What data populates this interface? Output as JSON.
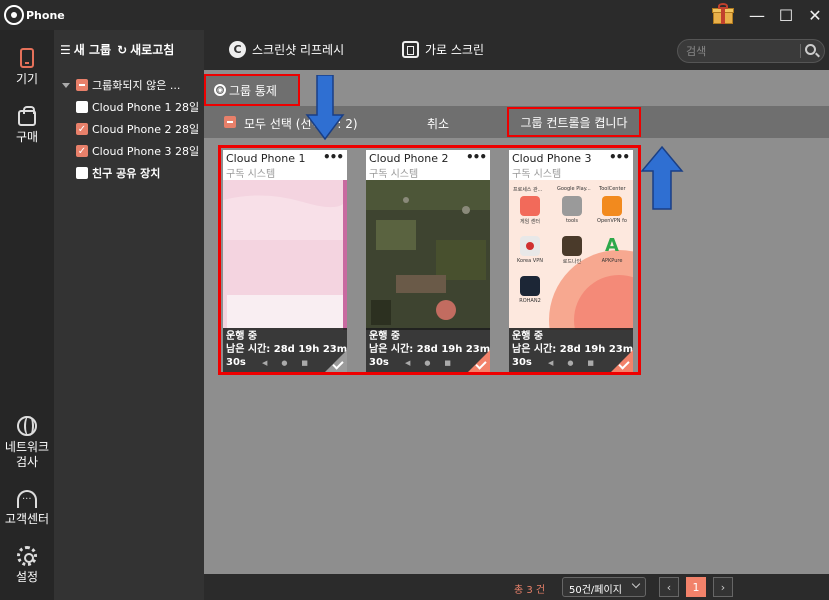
{
  "app": {
    "title": "Phone"
  },
  "nav": {
    "devices": "기기",
    "purchase": "구매",
    "network_1": "네트워크",
    "network_2": "검사",
    "support": "고객센터",
    "settings": "설정"
  },
  "groups": {
    "new_group": "새 그룹",
    "refresh": "새로고침",
    "ungrouped": "그룹화되지 않은 ...",
    "items": [
      {
        "label": "Cloud Phone 1 28일",
        "checked": false
      },
      {
        "label": "Cloud Phone 2 28일",
        "checked": true
      },
      {
        "label": "Cloud Phone 3 28일",
        "checked": true
      }
    ],
    "friend_share": "친구 공유 장치"
  },
  "toolbar": {
    "screenshot_refresh": "스크린샷 리프레시",
    "landscape": "가로 스크린",
    "search_placeholder": "검색"
  },
  "control": {
    "group_control": "그룹 통제",
    "select_all": "모두 선택 (선택됨 : 2)",
    "cancel": "취소",
    "toggle_group_control": "그룹 컨트롤을 켭니다"
  },
  "phones": [
    {
      "name": "Cloud Phone 1",
      "subtitle": "구독 시스템",
      "status": "운행 중",
      "remaining": "남은 시간: 28d 19h 23min",
      "seconds": "30s",
      "selected": false
    },
    {
      "name": "Cloud Phone 2",
      "subtitle": "구독 시스템",
      "status": "운행 중",
      "remaining": "남은 시간: 28d 19h 23min",
      "seconds": "30s",
      "selected": true
    },
    {
      "name": "Cloud Phone 3",
      "subtitle": "구독 시스템",
      "status": "운행 중",
      "remaining": "남은 시간: 28d 19h 23min",
      "seconds": "30s",
      "selected": true
    }
  ],
  "phone3_screen": {
    "top_labels": [
      "프로세스 관...",
      "Google Play...",
      "ToolCenter"
    ],
    "apps": [
      {
        "name": "게임 센터",
        "color": "#f26a5a"
      },
      {
        "name": "tools",
        "color": "#9a9a9a"
      },
      {
        "name": "OpenVPN fo",
        "color": "#f28a1e"
      },
      {
        "name": "Korea VPN",
        "color": "#e8e8e8"
      },
      {
        "name": "로드나인",
        "color": "#4a3a2a"
      },
      {
        "name": "APKPure",
        "color": "#2ea84a"
      },
      {
        "name": "ROHAN2",
        "color": "#1c2636"
      }
    ]
  },
  "footer": {
    "total": "총 3 건",
    "per_page": "50건/페이지",
    "current_page": "1",
    "prev": "‹",
    "next": "›"
  },
  "colors": {
    "accent": "#f2826a",
    "highlight": "#e00000",
    "arrow": "#2f6fd2"
  }
}
